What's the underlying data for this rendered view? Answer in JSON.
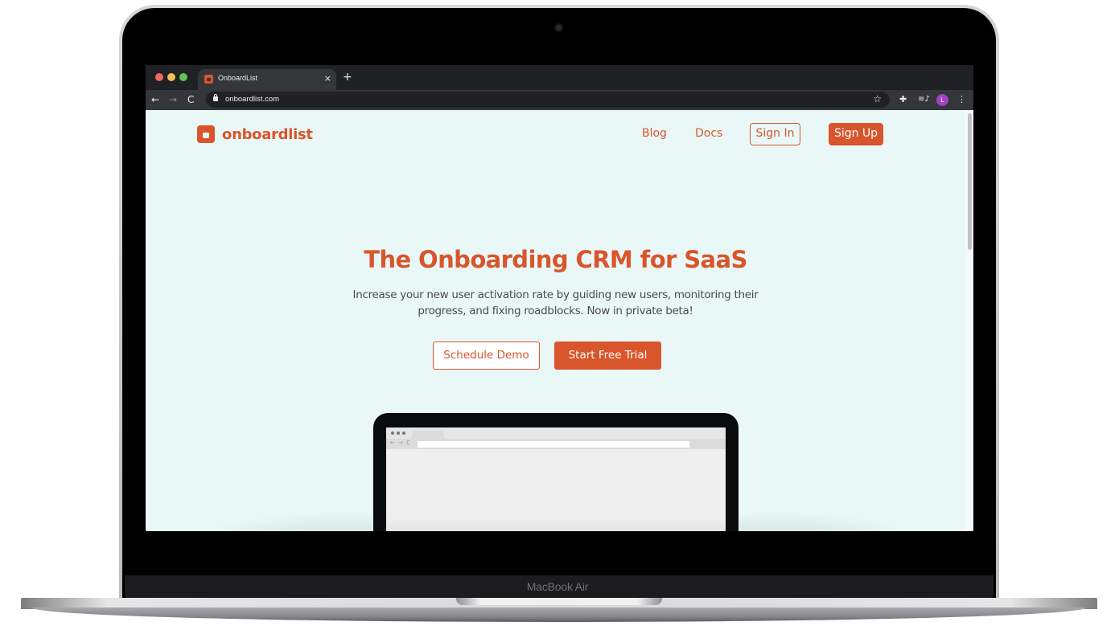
{
  "device": {
    "label": "MacBook Air"
  },
  "browser": {
    "tab": {
      "title": "OnboardList",
      "favicon": "onboardlist-favicon",
      "close_icon": "×"
    },
    "new_tab_icon": "+",
    "toolbar": {
      "back_icon": "←",
      "forward_icon": "→",
      "reload_icon": "C",
      "url": "onboardlist.com",
      "bookmark_icon": "☆",
      "extensions_icon": "✚",
      "media_icon": "≡♪",
      "profile_initial": "L",
      "menu_icon": "⋮"
    }
  },
  "site": {
    "brand": {
      "name": "onboardlist",
      "color": "#d9552b"
    },
    "nav": {
      "blog": "Blog",
      "docs": "Docs",
      "sign_in": "Sign In",
      "sign_up": "Sign Up"
    },
    "hero": {
      "title": "The Onboarding CRM for SaaS",
      "subtitle_line1": "Increase your new user activation rate by guiding new users, monitoring their",
      "subtitle_line2": "progress, and fixing roadblocks. Now in private beta!",
      "schedule_demo": "Schedule Demo",
      "start_trial": "Start Free Trial"
    },
    "illustration": {
      "nav_icons": "← → C"
    },
    "background_color": "#e9f8f7"
  }
}
